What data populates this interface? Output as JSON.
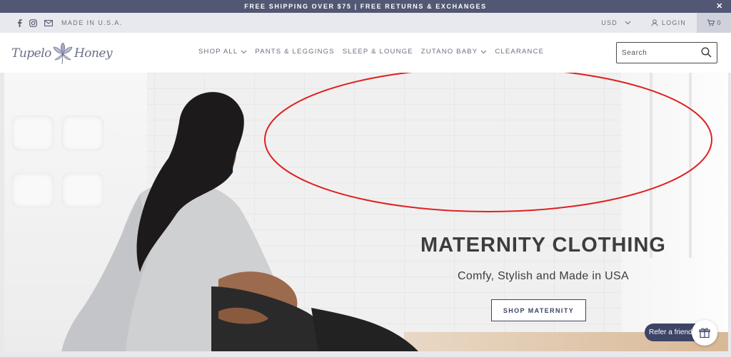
{
  "announcement": {
    "text": "FREE SHIPPING OVER $75 | FREE RETURNS & EXCHANGES",
    "close_icon": "close-icon"
  },
  "utility": {
    "social_icons": [
      "facebook-icon",
      "instagram-icon",
      "mail-icon"
    ],
    "made_in": "MADE IN U.S.A.",
    "currency": "USD",
    "login": "LOGIN",
    "cart_count": "0"
  },
  "header": {
    "logo_left": "Tupelo",
    "logo_right": "Honey",
    "nav": [
      "SHOP ALL",
      "PANTS & LEGGINGS",
      "SLEEP & LOUNGE",
      "ZUTANO BABY",
      "CLEARANCE"
    ],
    "search_placeholder": "Search"
  },
  "hero": {
    "title": "MATERNITY CLOTHING",
    "subtitle": "Comfy, Stylish and Made in USA",
    "button": "SHOP MATERNITY"
  },
  "refer": {
    "label": "Refer a friend",
    "icon": "gift-icon"
  },
  "colors": {
    "announce_bg": "#525873",
    "accent": "#3e4466",
    "annotation": "#e02020"
  }
}
